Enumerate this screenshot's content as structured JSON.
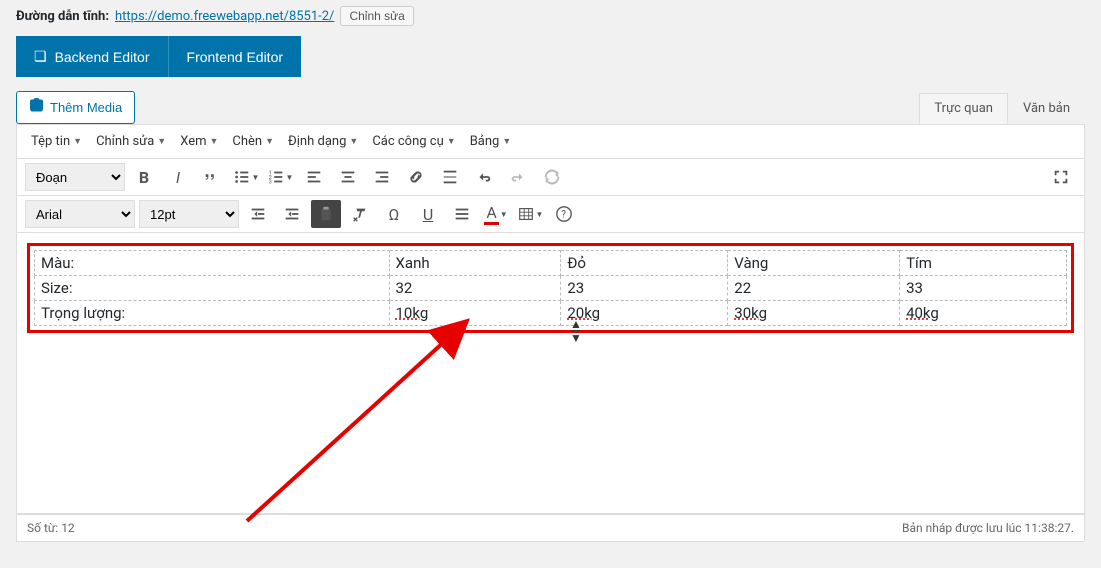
{
  "permalink": {
    "label": "Đường dẫn tĩnh:",
    "url": "https://demo.freewebapp.net/8551-2/",
    "edit": "Chỉnh sửa"
  },
  "editor_switch": {
    "backend": "Backend Editor",
    "frontend": "Frontend Editor"
  },
  "add_media": "Thêm Media",
  "tabs": {
    "visual": "Trực quan",
    "text": "Văn bản"
  },
  "menubar": {
    "file": "Tệp tin",
    "edit": "Chỉnh sửa",
    "view": "Xem",
    "insert": "Chèn",
    "format": "Định dạng",
    "tools": "Các công cụ",
    "table": "Bảng"
  },
  "toolbar1": {
    "format": "Đoạn"
  },
  "toolbar2": {
    "font": "Arial",
    "size": "12pt"
  },
  "table": {
    "rows": [
      [
        "Màu:",
        "Xanh",
        "Đỏ",
        "Vàng",
        "Tím"
      ],
      [
        "Size:",
        "32",
        "23",
        "22",
        "33"
      ],
      [
        "Trọng lượng:",
        "10kg",
        "20kg",
        "30kg",
        "40kg"
      ]
    ]
  },
  "status": {
    "wordcount_label": "Số từ:",
    "wordcount": "12",
    "draft_saved": "Bản nháp được lưu lúc 11:38:27."
  }
}
